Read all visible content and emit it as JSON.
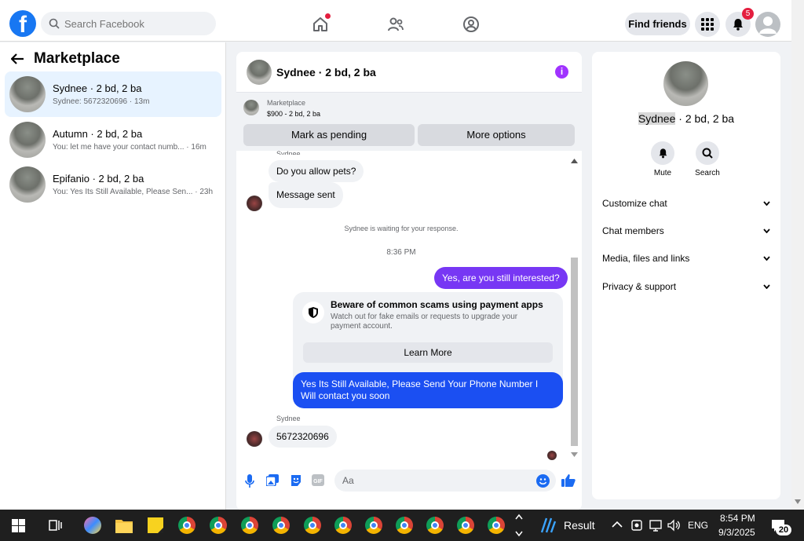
{
  "header": {
    "search_placeholder": "Search Facebook",
    "find_friends": "Find friends",
    "notif_count": "5"
  },
  "sidebar": {
    "title": "Marketplace",
    "conversations": [
      {
        "name": "Sydnee · 2 bd, 2 ba",
        "preview": "Sydnee: 5672320696 · 13m"
      },
      {
        "name": "Autumn · 2 bd, 2 ba",
        "preview": "You: let me have your contact numb... · 16m"
      },
      {
        "name": "Epifanio · 2 bd, 2 ba",
        "preview": "You: Yes Its Still Available, Please Sen... · 23h"
      }
    ]
  },
  "chat": {
    "title": "Sydnee · 2 bd, 2 ba",
    "listing_label": "Marketplace",
    "listing_price": "$900 - 2 bd, 2 ba",
    "mark_pending": "Mark as pending",
    "more_options": "More options",
    "messages": {
      "partial_sender": "Sydnee",
      "pets": "Do you allow pets?",
      "sent": "Message sent",
      "waiting": "Sydnee is waiting for your response.",
      "time": "8:36 PM",
      "interested": "Yes, are you still interested?",
      "scam_title": "Beware of common scams using payment apps",
      "scam_desc": "Watch out for fake emails or requests to upgrade your payment account.",
      "learn_more": "Learn More",
      "reply": "Yes Its Still Available, Please Send Your Phone Number I Will contact you soon",
      "sender": "Sydnee",
      "phone": "5672320696"
    },
    "composer_placeholder": "Aa"
  },
  "details": {
    "name_highlight": "Sydnee",
    "name_rest": " · 2 bd, 2 ba",
    "mute": "Mute",
    "search": "Search",
    "sections": [
      "Customize chat",
      "Chat members",
      "Media, files and links",
      "Privacy & support"
    ]
  },
  "taskbar": {
    "result": "Result",
    "lang": "ENG",
    "time": "8:54 PM",
    "date": "9/3/2025",
    "notif": "20"
  }
}
